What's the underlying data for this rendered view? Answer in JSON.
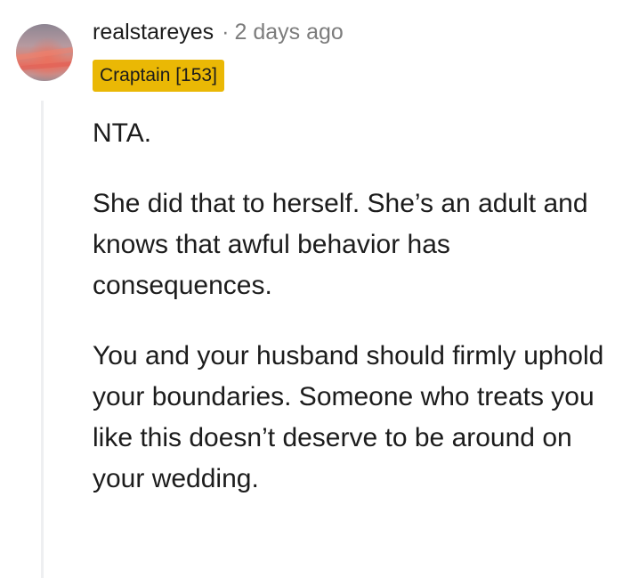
{
  "comment": {
    "author": "realstareyes",
    "separator": "·",
    "timestamp": "2 days ago",
    "flair": "Craptain [153]",
    "flair_color": "#eab805",
    "avatar_icon": "avatar-image-icon",
    "paragraphs": [
      "NTA.",
      "She did that to herself. She’s an adult and knows that awful behavior has consequences.",
      "You and your husband should firmly uphold your boundaries. Someone who treats you like this doesn’t deserve to be around on your wedding."
    ]
  }
}
